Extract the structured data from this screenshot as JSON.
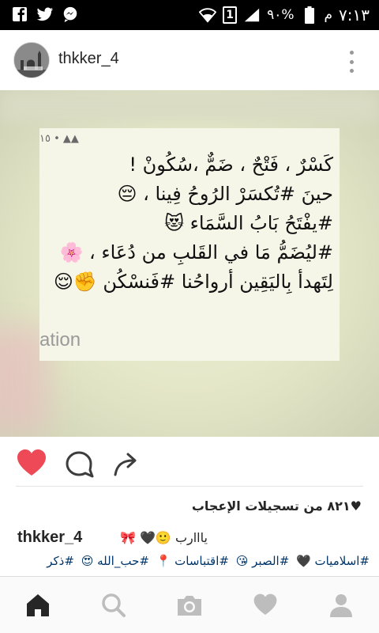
{
  "status_bar": {
    "time": "٧:١٣",
    "ampm": "م",
    "battery": "٩٠%",
    "sim": "1",
    "icons": [
      "facebook-icon",
      "twitter-icon",
      "messenger-icon",
      "wifi-icon",
      "signal-icon",
      "battery-icon"
    ]
  },
  "post": {
    "username": "thkker_4",
    "card_meta": "١٥ • ▲▲",
    "quote_lines": [
      "كَسْرٌ ، فَتْحٌ ، ضَمٌّ ،سُكُونْ !",
      "حينَ #تُكسَرْ الرُوحُ فِينا ، 😔",
      "#يفْتَحُ بَابُ السَّمَاء 😻",
      "#ليُضَمُّ مَا في القَلبِ من دُعَاء ، 🌸",
      "لِتَهدأ بِاليَقِين أرواحُنا #فَنسْكُن ✊😌"
    ],
    "card_watermark": "ation"
  },
  "actions": {
    "like_icon": "heart-filled-icon",
    "comment_icon": "comment-icon",
    "share_icon": "share-icon",
    "like_color": "#ed4956"
  },
  "likes_text": "♥٨٢١ من تسجيلات الإعجاب",
  "caption": {
    "username": "thkker_4",
    "text": "يااارب 🙂🖤 🎀"
  },
  "tags": [
    "#اسلاميات 🖤",
    "#الصبر 😘",
    "#اقتباسات 📍",
    "#حب_الله 😍",
    "#ذكر"
  ],
  "bottom_nav": [
    "home-icon",
    "search-icon",
    "camera-icon",
    "heart-icon",
    "profile-icon"
  ]
}
